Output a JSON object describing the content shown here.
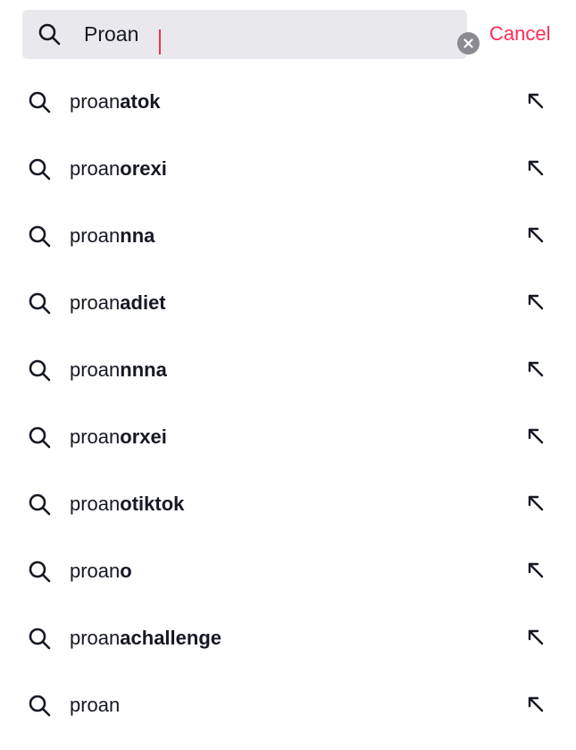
{
  "search": {
    "query": "Proan",
    "search_icon": "search-icon",
    "clear_icon": "close-circle-icon",
    "cancel_label": "Cancel",
    "accent_color": "#fe2c55",
    "field_background": "#e9e9ed"
  },
  "suggestions": [
    {
      "prefix": "proan",
      "suffix": "atok"
    },
    {
      "prefix": "proan",
      "suffix": "orexi"
    },
    {
      "prefix": "proan",
      "suffix": "nna"
    },
    {
      "prefix": "proan",
      "suffix": "adiet"
    },
    {
      "prefix": "proan",
      "suffix": "nnna"
    },
    {
      "prefix": "proan",
      "suffix": "orxei"
    },
    {
      "prefix": "proan",
      "suffix": "otiktok"
    },
    {
      "prefix": "proan",
      "suffix": "o"
    },
    {
      "prefix": "proan",
      "suffix": "achallenge"
    },
    {
      "prefix": "proan",
      "suffix": ""
    }
  ],
  "suggestion_icons": {
    "leading": "search-icon",
    "trailing": "arrow-up-left-icon"
  }
}
